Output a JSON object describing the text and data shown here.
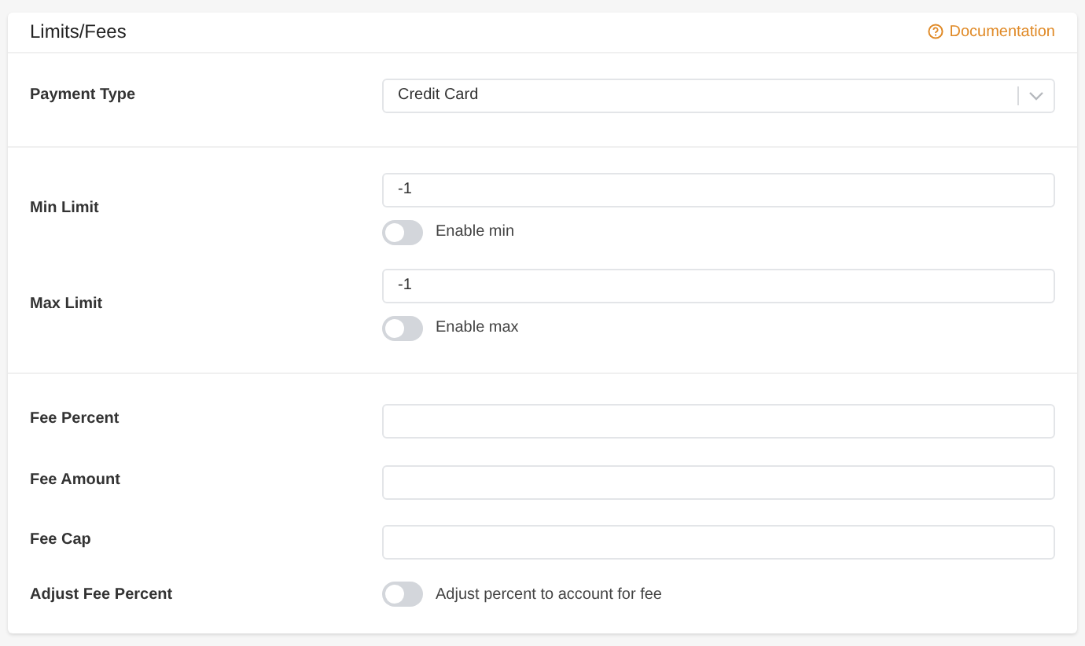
{
  "header": {
    "title": "Limits/Fees",
    "link": "Documentation"
  },
  "sections": [
    {
      "rows": [
        {
          "kind": "select",
          "label": "Payment Type",
          "value": "Credit Card"
        }
      ]
    },
    {
      "rows": [
        {
          "kind": "input_toggle",
          "label": "Min Limit",
          "value": "-1",
          "toggle": {
            "label": "Enable min",
            "on": false
          }
        },
        {
          "kind": "input_toggle",
          "label": "Max Limit",
          "value": "-1",
          "toggle": {
            "label": "Enable max",
            "on": false
          }
        }
      ]
    },
    {
      "rows": [
        {
          "kind": "input",
          "label": "Fee Percent"
        },
        {
          "kind": "input",
          "label": "Fee Amount"
        },
        {
          "kind": "input",
          "label": "Fee Cap"
        },
        {
          "kind": "toggle",
          "label": "Adjust Fee Percent",
          "toggle": {
            "label": "Adjust percent to account for fee",
            "on": false
          }
        }
      ]
    }
  ]
}
